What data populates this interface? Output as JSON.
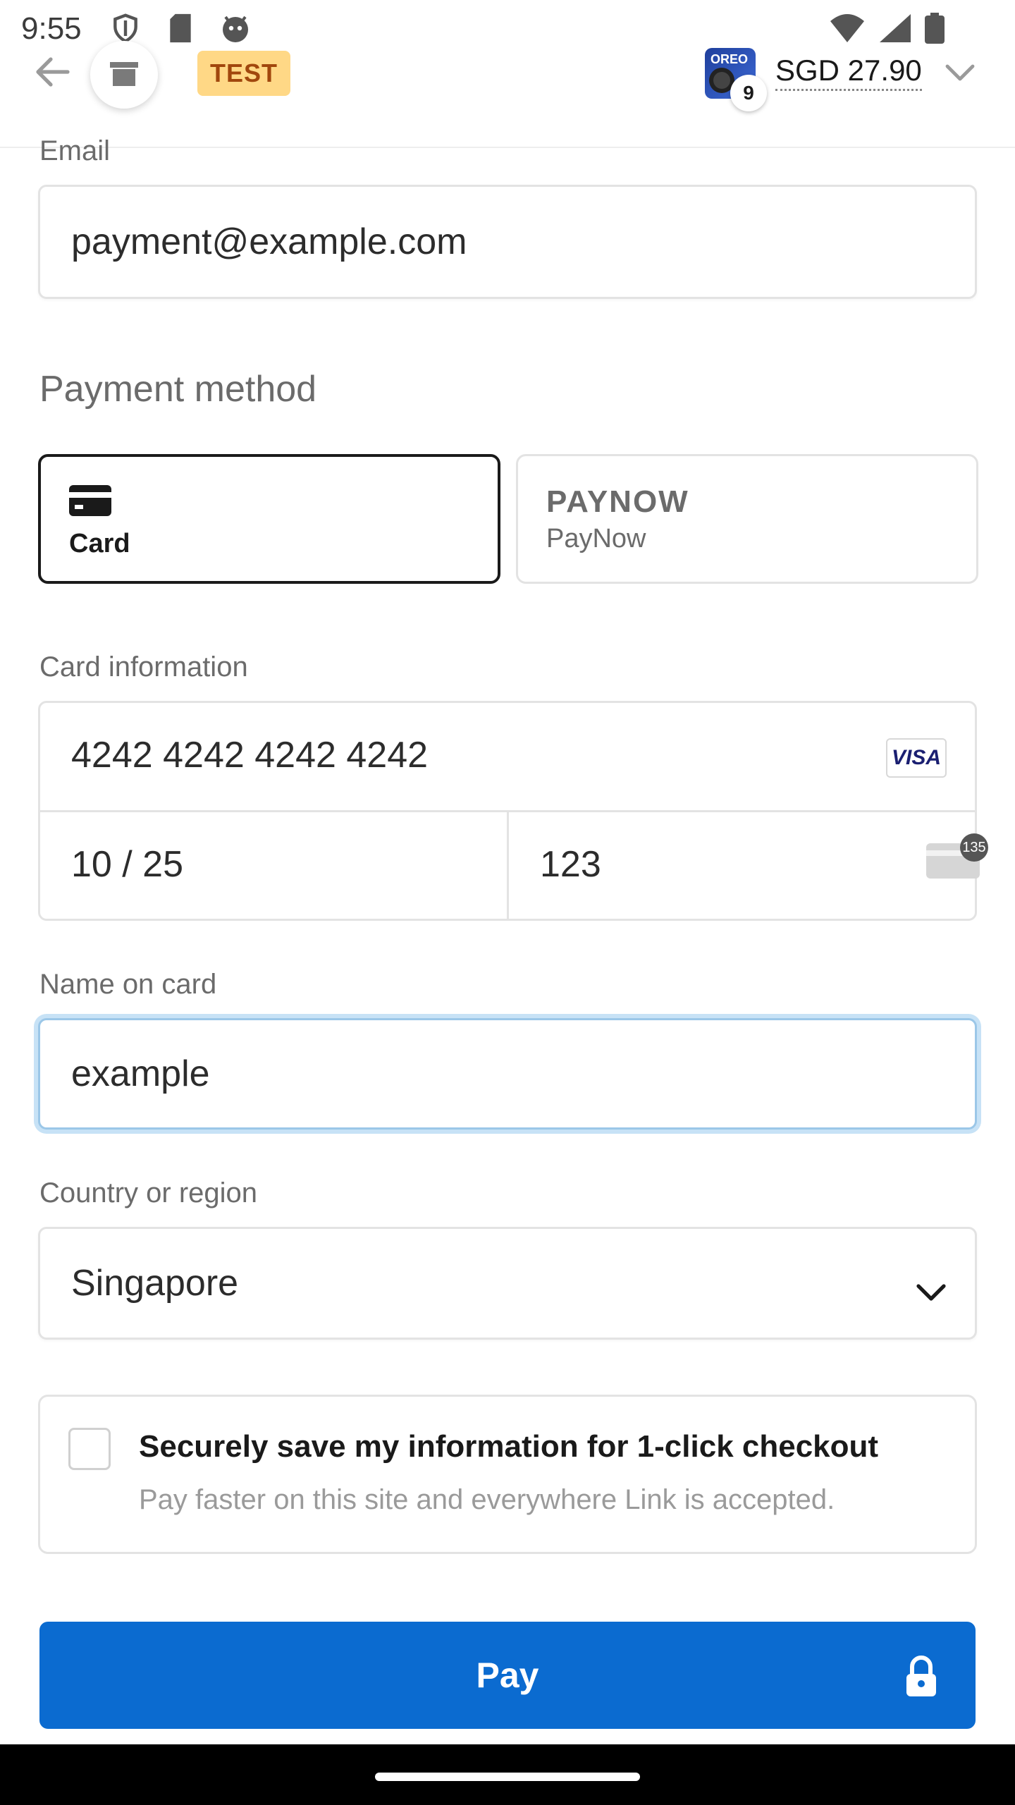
{
  "status_bar": {
    "time": "9:55",
    "left_icons": [
      "shield-icon",
      "sd-card-icon",
      "android-icon"
    ],
    "right_icons": [
      "wifi-icon",
      "signal-icon",
      "battery-icon"
    ]
  },
  "header": {
    "back_icon": "arrow-left-icon",
    "store_icon": "store-icon",
    "test_badge": "TEST",
    "product_thumb_text": "OREO",
    "quantity": "9",
    "price": "SGD 27.90",
    "price_toggle_icon": "chevron-down-icon"
  },
  "form": {
    "email_label": "Email",
    "email_value": "payment@example.com",
    "payment_method_title": "Payment method",
    "methods": [
      {
        "label": "Card",
        "icon": "card-icon",
        "selected": true
      },
      {
        "label": "PayNow",
        "logo_text": "PAYNOW",
        "icon": "paynow-logo",
        "selected": false
      }
    ],
    "card_info_label": "Card information",
    "card_number": "4242 4242 4242 4242",
    "card_brand": "VISA",
    "expiry": "10 / 25",
    "cvc": "123",
    "cvc_badge": "135",
    "name_label": "Name on card",
    "name_value": "example",
    "country_label": "Country or region",
    "country_value": "Singapore",
    "save_title": "Securely save my information for 1-click checkout",
    "save_subtitle": "Pay faster on this site and everywhere Link is accepted.",
    "pay_label": "Pay"
  },
  "colors": {
    "pay_button": "#0b6bd0",
    "test_badge_bg": "#ffd886",
    "test_badge_text": "#a1470d",
    "focus_ring": "#9bc7e8"
  }
}
